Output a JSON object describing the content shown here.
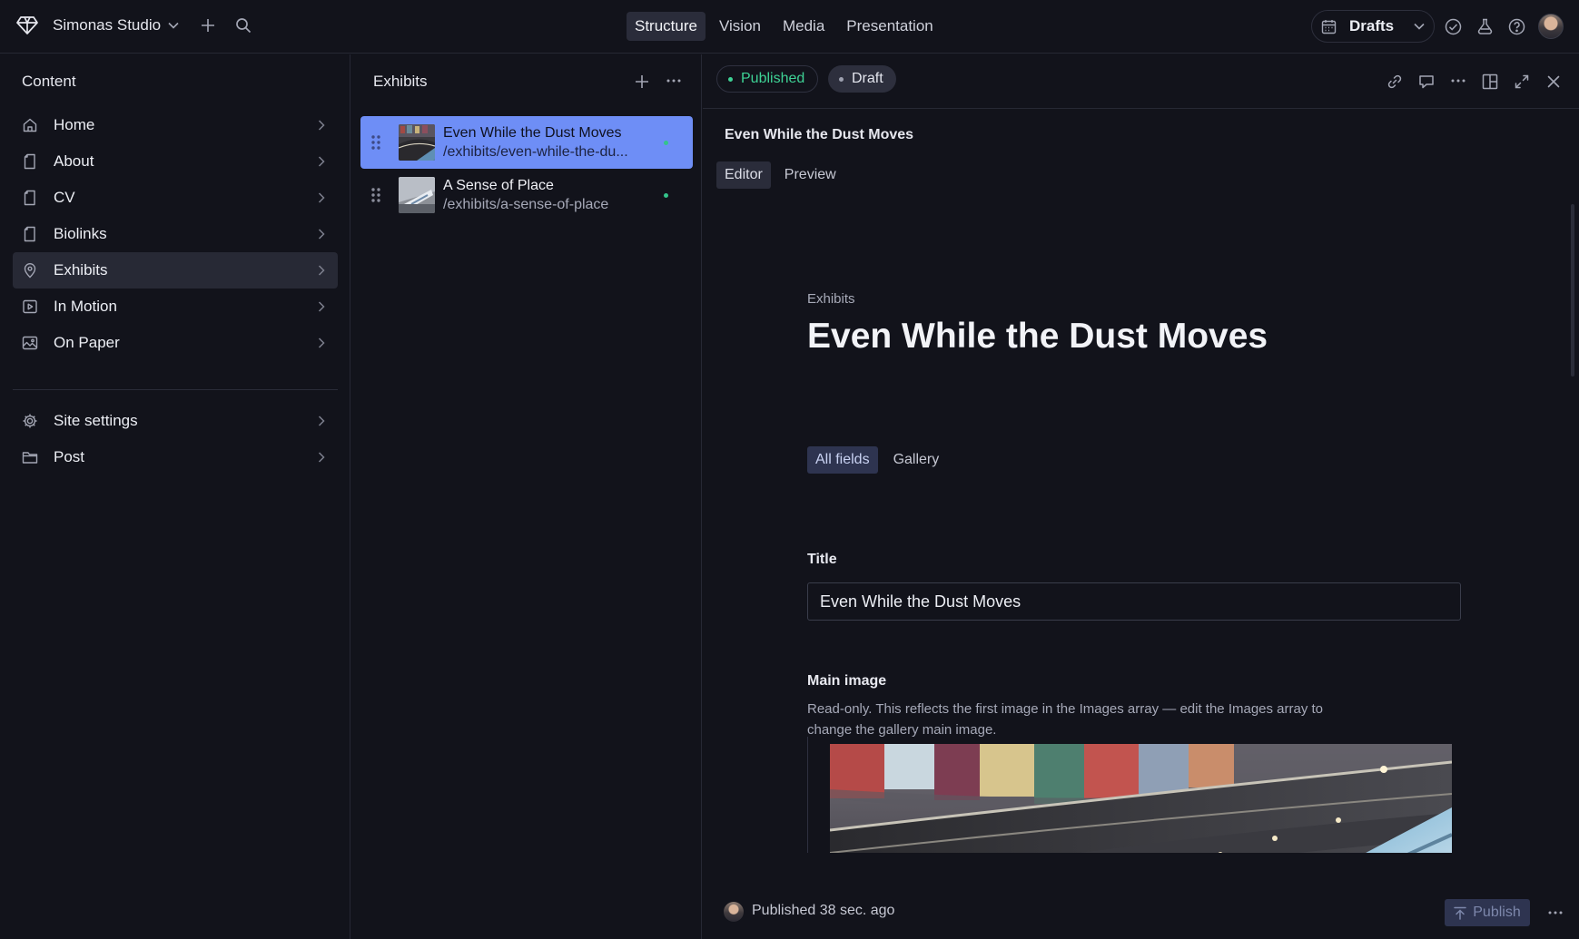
{
  "topbar": {
    "studio_name": "Simonas Studio",
    "tabs": [
      {
        "label": "Structure",
        "active": true
      },
      {
        "label": "Vision",
        "active": false
      },
      {
        "label": "Media",
        "active": false
      },
      {
        "label": "Presentation",
        "active": false
      }
    ],
    "drafts_label": "Drafts",
    "icons": [
      "logo-diamond-icon",
      "chevron-down-icon",
      "plus-icon",
      "search-icon",
      "calendar-icon",
      "check-circle-icon",
      "flask-icon",
      "help-icon",
      "avatar"
    ]
  },
  "sidebar": {
    "heading": "Content",
    "items": [
      {
        "label": "Home",
        "icon": "home-icon"
      },
      {
        "label": "About",
        "icon": "document-icon"
      },
      {
        "label": "CV",
        "icon": "document-icon"
      },
      {
        "label": "Biolinks",
        "icon": "document-icon"
      },
      {
        "label": "Exhibits",
        "icon": "pin-icon",
        "active": true
      },
      {
        "label": "In Motion",
        "icon": "play-icon"
      },
      {
        "label": "On Paper",
        "icon": "image-icon"
      },
      {
        "label": "Site settings",
        "icon": "gear-icon"
      },
      {
        "label": "Post",
        "icon": "folder-icon"
      }
    ]
  },
  "list": {
    "heading": "Exhibits",
    "rows": [
      {
        "title": "Even While the Dust Moves",
        "path": "/exhibits/even-while-the-du...",
        "active": true
      },
      {
        "title": "A Sense of Place",
        "path": "/exhibits/a-sense-of-place",
        "active": false
      }
    ]
  },
  "document": {
    "status_published": "Published",
    "status_draft": "Draft",
    "title": "Even While the Dust Moves",
    "tabs": [
      {
        "label": "Editor",
        "active": true
      },
      {
        "label": "Preview",
        "active": false
      }
    ],
    "breadcrumb": "Exhibits",
    "heading": "Even While the Dust Moves",
    "field_tabs": [
      {
        "label": "All fields",
        "active": true
      },
      {
        "label": "Gallery",
        "active": false
      }
    ],
    "title_field": {
      "label": "Title",
      "value": "Even While the Dust Moves"
    },
    "main_image": {
      "label": "Main image",
      "help": "Read-only. This reflects the first image in the Images array — edit the Images array to change the gallery main image."
    },
    "footer": {
      "status": "Published 38 sec. ago",
      "publish_label": "Publish"
    }
  },
  "colors": {
    "background": "#12131b",
    "accent": "#6e8ef6",
    "published_green": "#3ed295"
  }
}
